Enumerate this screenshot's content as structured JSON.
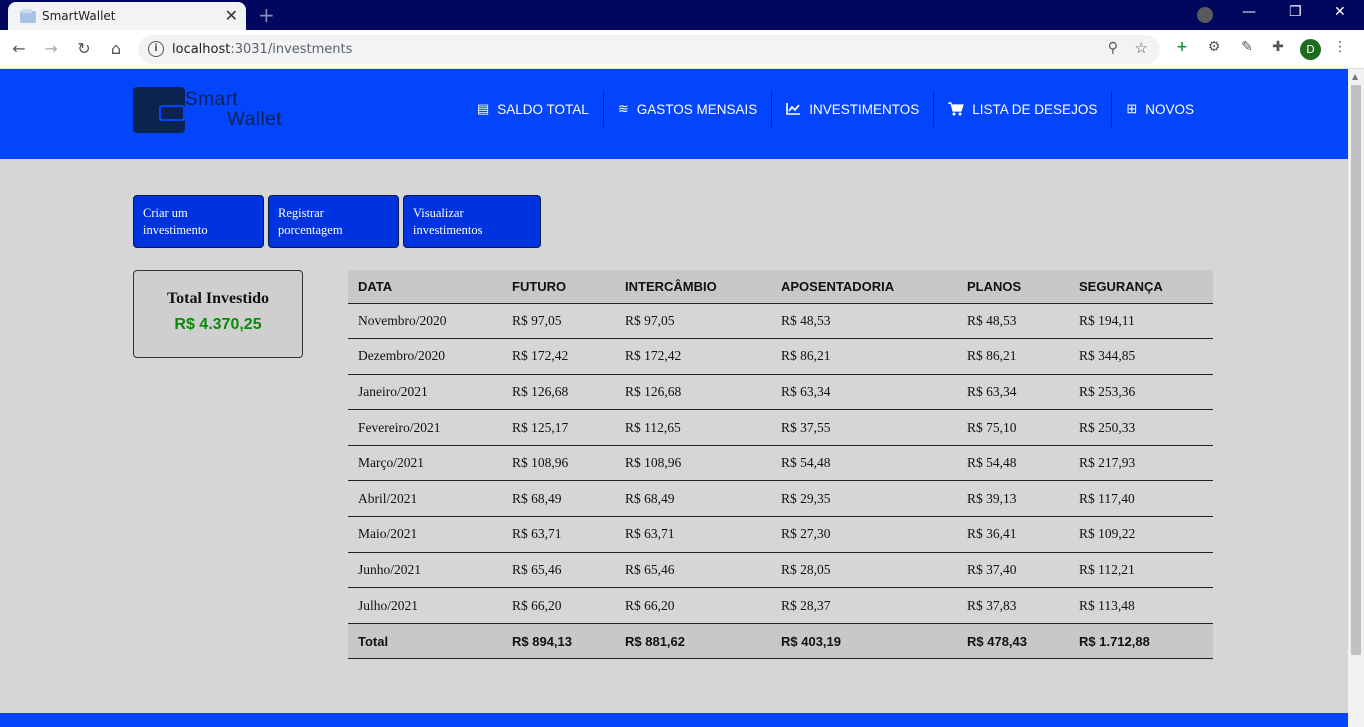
{
  "browser": {
    "tab_title": "SmartWallet",
    "url_host": "localhost",
    "url_path": ":3031/investments",
    "profile_initial": "D"
  },
  "navbar": {
    "logo_line1": "Smart",
    "logo_line2": "Wallet",
    "items": [
      {
        "label": "SALDO TOTAL",
        "icon": "receipt-icon"
      },
      {
        "label": "GASTOS MENSAIS",
        "icon": "coins-icon"
      },
      {
        "label": "INVESTIMENTOS",
        "icon": "chart-line-icon"
      },
      {
        "label": "LISTA DE DESEJOS",
        "icon": "cart-icon"
      },
      {
        "label": "NOVOS",
        "icon": "plus-square-icon"
      }
    ]
  },
  "actions": [
    {
      "line1": "Criar um",
      "line2": "investimento"
    },
    {
      "line1": "Registrar",
      "line2": "porcentagem"
    },
    {
      "line1": "Visualizar",
      "line2": "investimentos"
    }
  ],
  "summary": {
    "title": "Total Investido",
    "value": "R$ 4.370,25",
    "value_color": "#0a8a0a"
  },
  "table": {
    "headers": [
      "DATA",
      "FUTURO",
      "INTERCÂMBIO",
      "APOSENTADORIA",
      "PLANOS",
      "SEGURANÇA"
    ],
    "rows": [
      [
        "Novembro/2020",
        "R$ 97,05",
        "R$ 97,05",
        "R$ 48,53",
        "R$ 48,53",
        "R$ 194,11"
      ],
      [
        "Dezembro/2020",
        "R$ 172,42",
        "R$ 172,42",
        "R$ 86,21",
        "R$ 86,21",
        "R$ 344,85"
      ],
      [
        "Janeiro/2021",
        "R$ 126,68",
        "R$ 126,68",
        "R$ 63,34",
        "R$ 63,34",
        "R$ 253,36"
      ],
      [
        "Fevereiro/2021",
        "R$ 125,17",
        "R$ 112,65",
        "R$ 37,55",
        "R$ 75,10",
        "R$ 250,33"
      ],
      [
        "Março/2021",
        "R$ 108,96",
        "R$ 108,96",
        "R$ 54,48",
        "R$ 54,48",
        "R$ 217,93"
      ],
      [
        "Abril/2021",
        "R$ 68,49",
        "R$ 68,49",
        "R$ 29,35",
        "R$ 39,13",
        "R$ 117,40"
      ],
      [
        "Maio/2021",
        "R$ 63,71",
        "R$ 63,71",
        "R$ 27,30",
        "R$ 36,41",
        "R$ 109,22"
      ],
      [
        "Junho/2021",
        "R$ 65,46",
        "R$ 65,46",
        "R$ 28,05",
        "R$ 37,40",
        "R$ 112,21"
      ],
      [
        "Julho/2021",
        "R$ 66,20",
        "R$ 66,20",
        "R$ 28,37",
        "R$ 37,83",
        "R$ 113,48"
      ]
    ],
    "total_row": [
      "Total",
      "R$ 894,13",
      "R$ 881,62",
      "R$ 403,19",
      "R$ 478,43",
      "R$ 1.712,88"
    ]
  },
  "colors": {
    "navbar": "#0245fc",
    "button": "#0033e0",
    "background": "#d6d6d6"
  }
}
